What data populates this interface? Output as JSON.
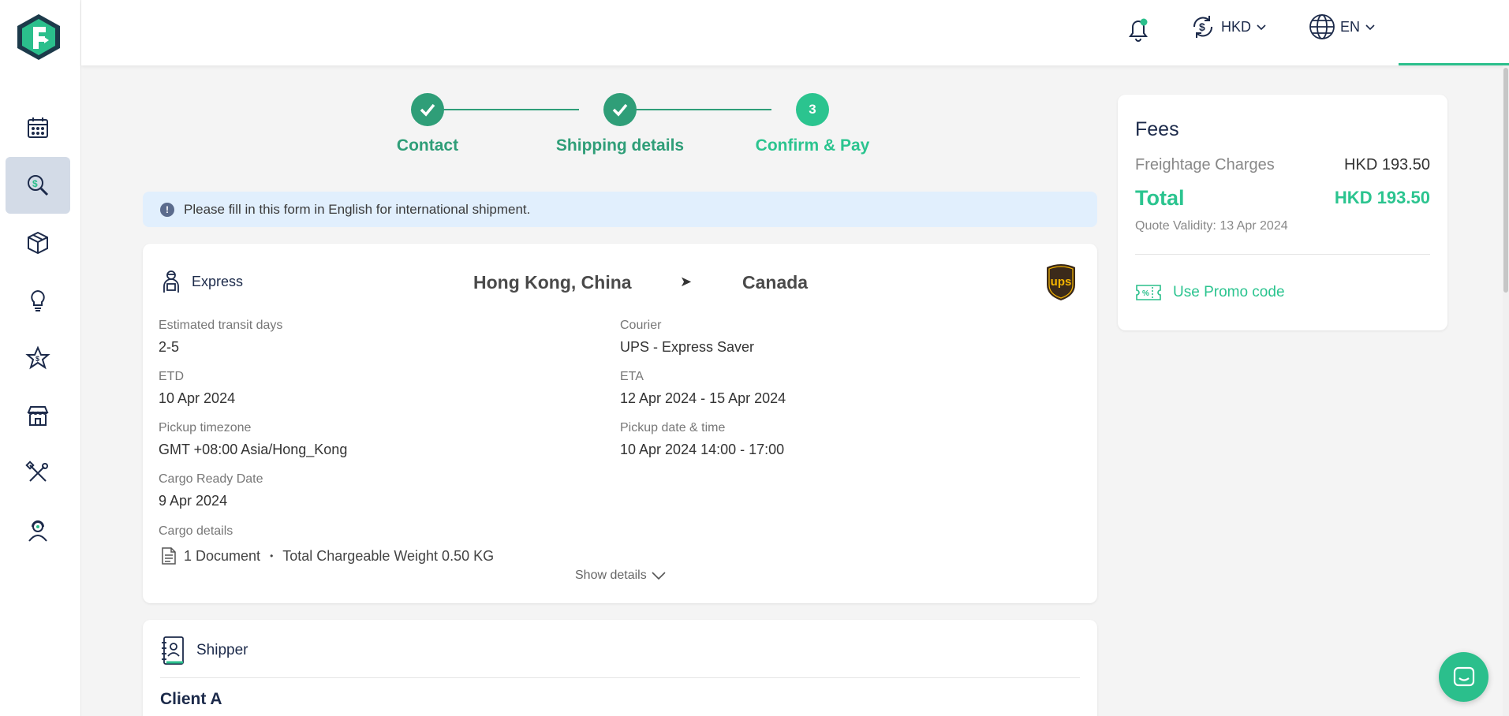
{
  "header": {
    "currency": "HKD",
    "language": "EN"
  },
  "sidebar": {
    "items": [
      {
        "icon": "calendar-icon"
      },
      {
        "icon": "search-dollar-icon",
        "active": true
      },
      {
        "icon": "package-icon"
      },
      {
        "icon": "lightbulb-icon"
      },
      {
        "icon": "star-dollar-icon"
      },
      {
        "icon": "store-icon"
      },
      {
        "icon": "tools-icon"
      },
      {
        "icon": "support-agent-icon"
      }
    ]
  },
  "stepper": {
    "steps": [
      {
        "label": "Contact",
        "state": "done"
      },
      {
        "label": "Shipping details",
        "state": "done"
      },
      {
        "label": "Confirm & Pay",
        "number": "3",
        "state": "current"
      }
    ]
  },
  "notice": {
    "text": "Please fill in this form in English for international shipment."
  },
  "shipment": {
    "service": "Express",
    "origin": "Hong Kong, China",
    "arrow": "➤",
    "destination": "Canada",
    "fields": {
      "transit_label": "Estimated transit days",
      "transit_value": "2-5",
      "courier_label": "Courier",
      "courier_value": "UPS - Express Saver",
      "etd_label": "ETD",
      "etd_value": "10 Apr 2024",
      "eta_label": "ETA",
      "eta_value": "12 Apr 2024 - 15 Apr 2024",
      "tz_label": "Pickup timezone",
      "tz_value": "GMT +08:00 Asia/Hong_Kong",
      "pickup_label": "Pickup date & time",
      "pickup_value": "10 Apr 2024 14:00 - 17:00",
      "ready_label": "Cargo Ready Date",
      "ready_value": "9 Apr 2024",
      "cargo_label": "Cargo details"
    },
    "cargo_count": "1 Document",
    "cargo_sep": "•",
    "cargo_weight": "Total Chargeable Weight 0.50 KG",
    "show_details": "Show details",
    "courier_logo_text": "ups"
  },
  "shipper": {
    "title": "Shipper",
    "client_name": "Client A"
  },
  "fees": {
    "title": "Fees",
    "freight_label": "Freightage Charges",
    "freight_value": "HKD 193.50",
    "total_label": "Total",
    "total_value": "HKD 193.50",
    "validity": "Quote Validity: 13 Apr 2024",
    "promo": "Use Promo code"
  },
  "colors": {
    "accent": "#2bc48f",
    "step_done": "#2f9e78",
    "navy": "#1c2a4a"
  }
}
